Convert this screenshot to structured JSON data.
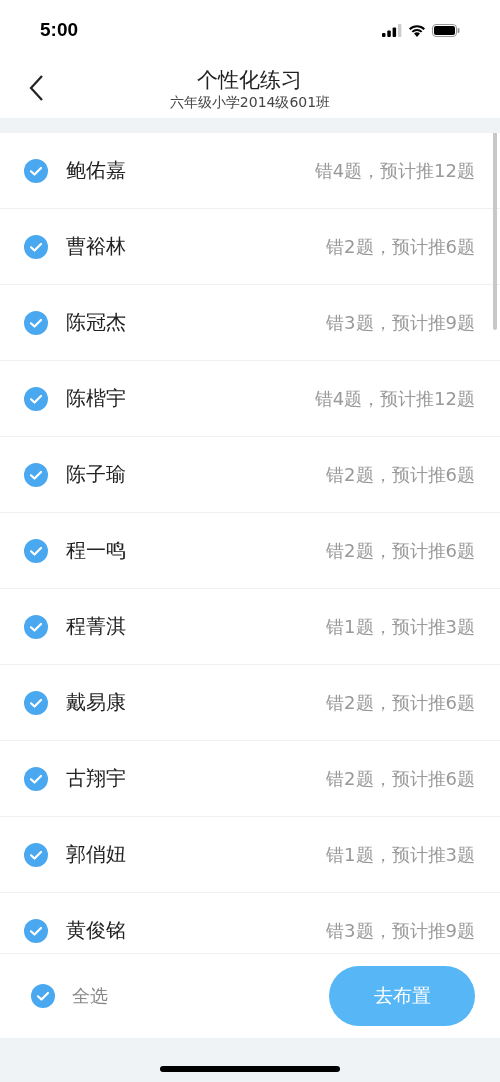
{
  "status_bar": {
    "time": "5:00"
  },
  "nav": {
    "title": "个性化练习",
    "subtitle": "六年级小学2014级601班"
  },
  "students": [
    {
      "name": "鲍佑嘉",
      "summary": "错4题，预计推12题",
      "checked": true
    },
    {
      "name": "曹裕林",
      "summary": "错2题，预计推6题",
      "checked": true
    },
    {
      "name": "陈冠杰",
      "summary": "错3题，预计推9题",
      "checked": true
    },
    {
      "name": "陈楷宇",
      "summary": "错4题，预计推12题",
      "checked": true
    },
    {
      "name": "陈子瑜",
      "summary": "错2题，预计推6题",
      "checked": true
    },
    {
      "name": "程一鸣",
      "summary": "错2题，预计推6题",
      "checked": true
    },
    {
      "name": "程菁淇",
      "summary": "错1题，预计推3题",
      "checked": true
    },
    {
      "name": "戴易康",
      "summary": "错2题，预计推6题",
      "checked": true
    },
    {
      "name": "古翔宇",
      "summary": "错2题，预计推6题",
      "checked": true
    },
    {
      "name": "郭俏妞",
      "summary": "错1题，预计推3题",
      "checked": true
    },
    {
      "name": "黄俊铭",
      "summary": "错3题，预计推9题",
      "checked": true
    }
  ],
  "footer": {
    "select_all": {
      "label": "全选",
      "checked": true
    },
    "button": "去布置"
  }
}
